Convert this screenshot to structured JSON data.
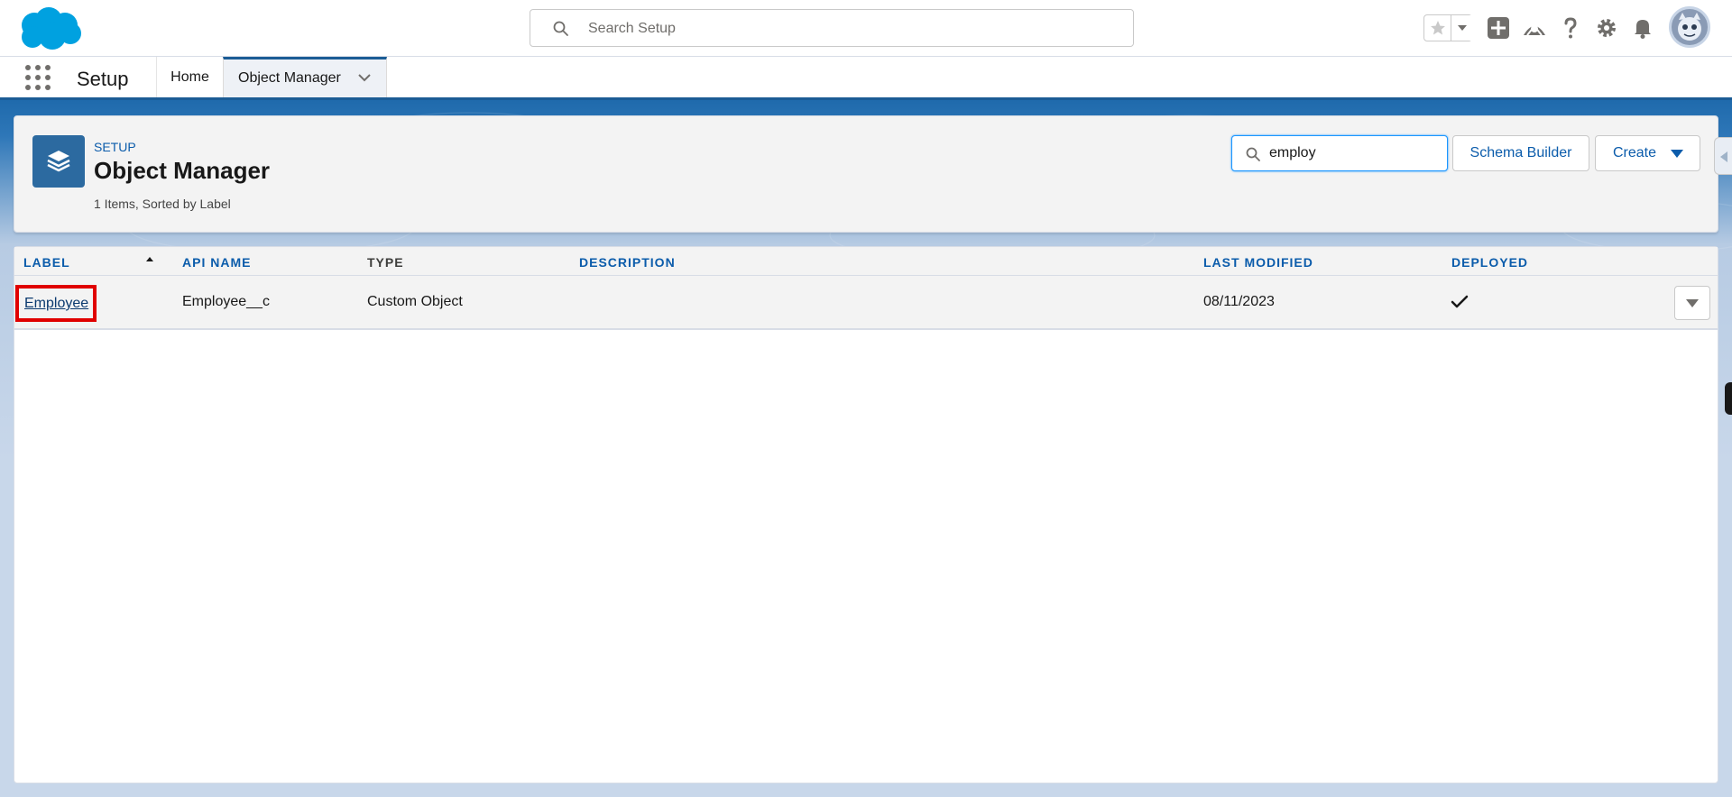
{
  "global_header": {
    "search_placeholder": "Search Setup"
  },
  "context_bar": {
    "app_name": "Setup",
    "tabs": [
      {
        "label": "Home"
      },
      {
        "label": "Object Manager"
      }
    ]
  },
  "page_header": {
    "eyebrow": "SETUP",
    "title": "Object Manager",
    "meta": "1 Items, Sorted by Label",
    "quick_find_value": "employ",
    "buttons": {
      "schema_builder": "Schema Builder",
      "create": "Create"
    }
  },
  "table": {
    "columns": [
      "LABEL",
      "API NAME",
      "TYPE",
      "DESCRIPTION",
      "LAST MODIFIED",
      "DEPLOYED"
    ],
    "rows": [
      {
        "label": "Employee",
        "api_name": "Employee__c",
        "type": "Custom Object",
        "description": "",
        "last_modified": "08/11/2023",
        "deployed": true
      }
    ]
  },
  "colors": {
    "brand": "#0b5cab",
    "cloud": "#00a1e0",
    "highlight": "#e00000"
  },
  "icons": [
    "salesforce-cloud-logo",
    "search-icon",
    "star-icon",
    "add-icon",
    "trailhead-icon",
    "help-icon",
    "gear-icon",
    "bell-icon",
    "avatar",
    "app-launcher-icon",
    "chevron-down-icon",
    "layers-icon",
    "checkmark-icon"
  ]
}
